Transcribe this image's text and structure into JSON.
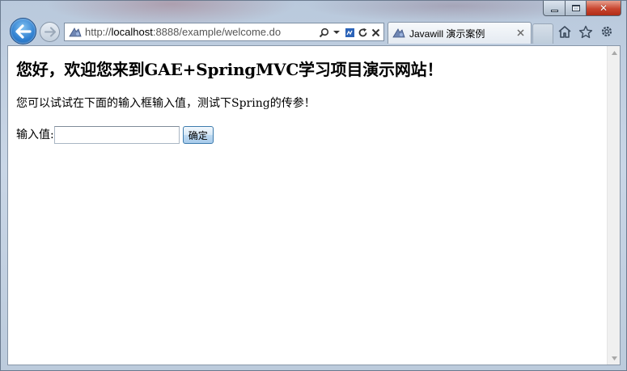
{
  "browser": {
    "address_url_prefix": "http://",
    "address_url_host": "localhost",
    "address_url_rest": ":8888/example/welcome.do",
    "tab_title": "Javawill 演示案例",
    "accent_color": "#2f7fd0"
  },
  "page": {
    "heading": "您好，欢迎您来到GAE+SpringMVC学习项目演示网站！",
    "intro": "您可以试试在下面的输入框输入值，测试下Spring的传参！",
    "form": {
      "input_label": "输入值:",
      "input_value": "",
      "submit_label": "确定"
    }
  }
}
